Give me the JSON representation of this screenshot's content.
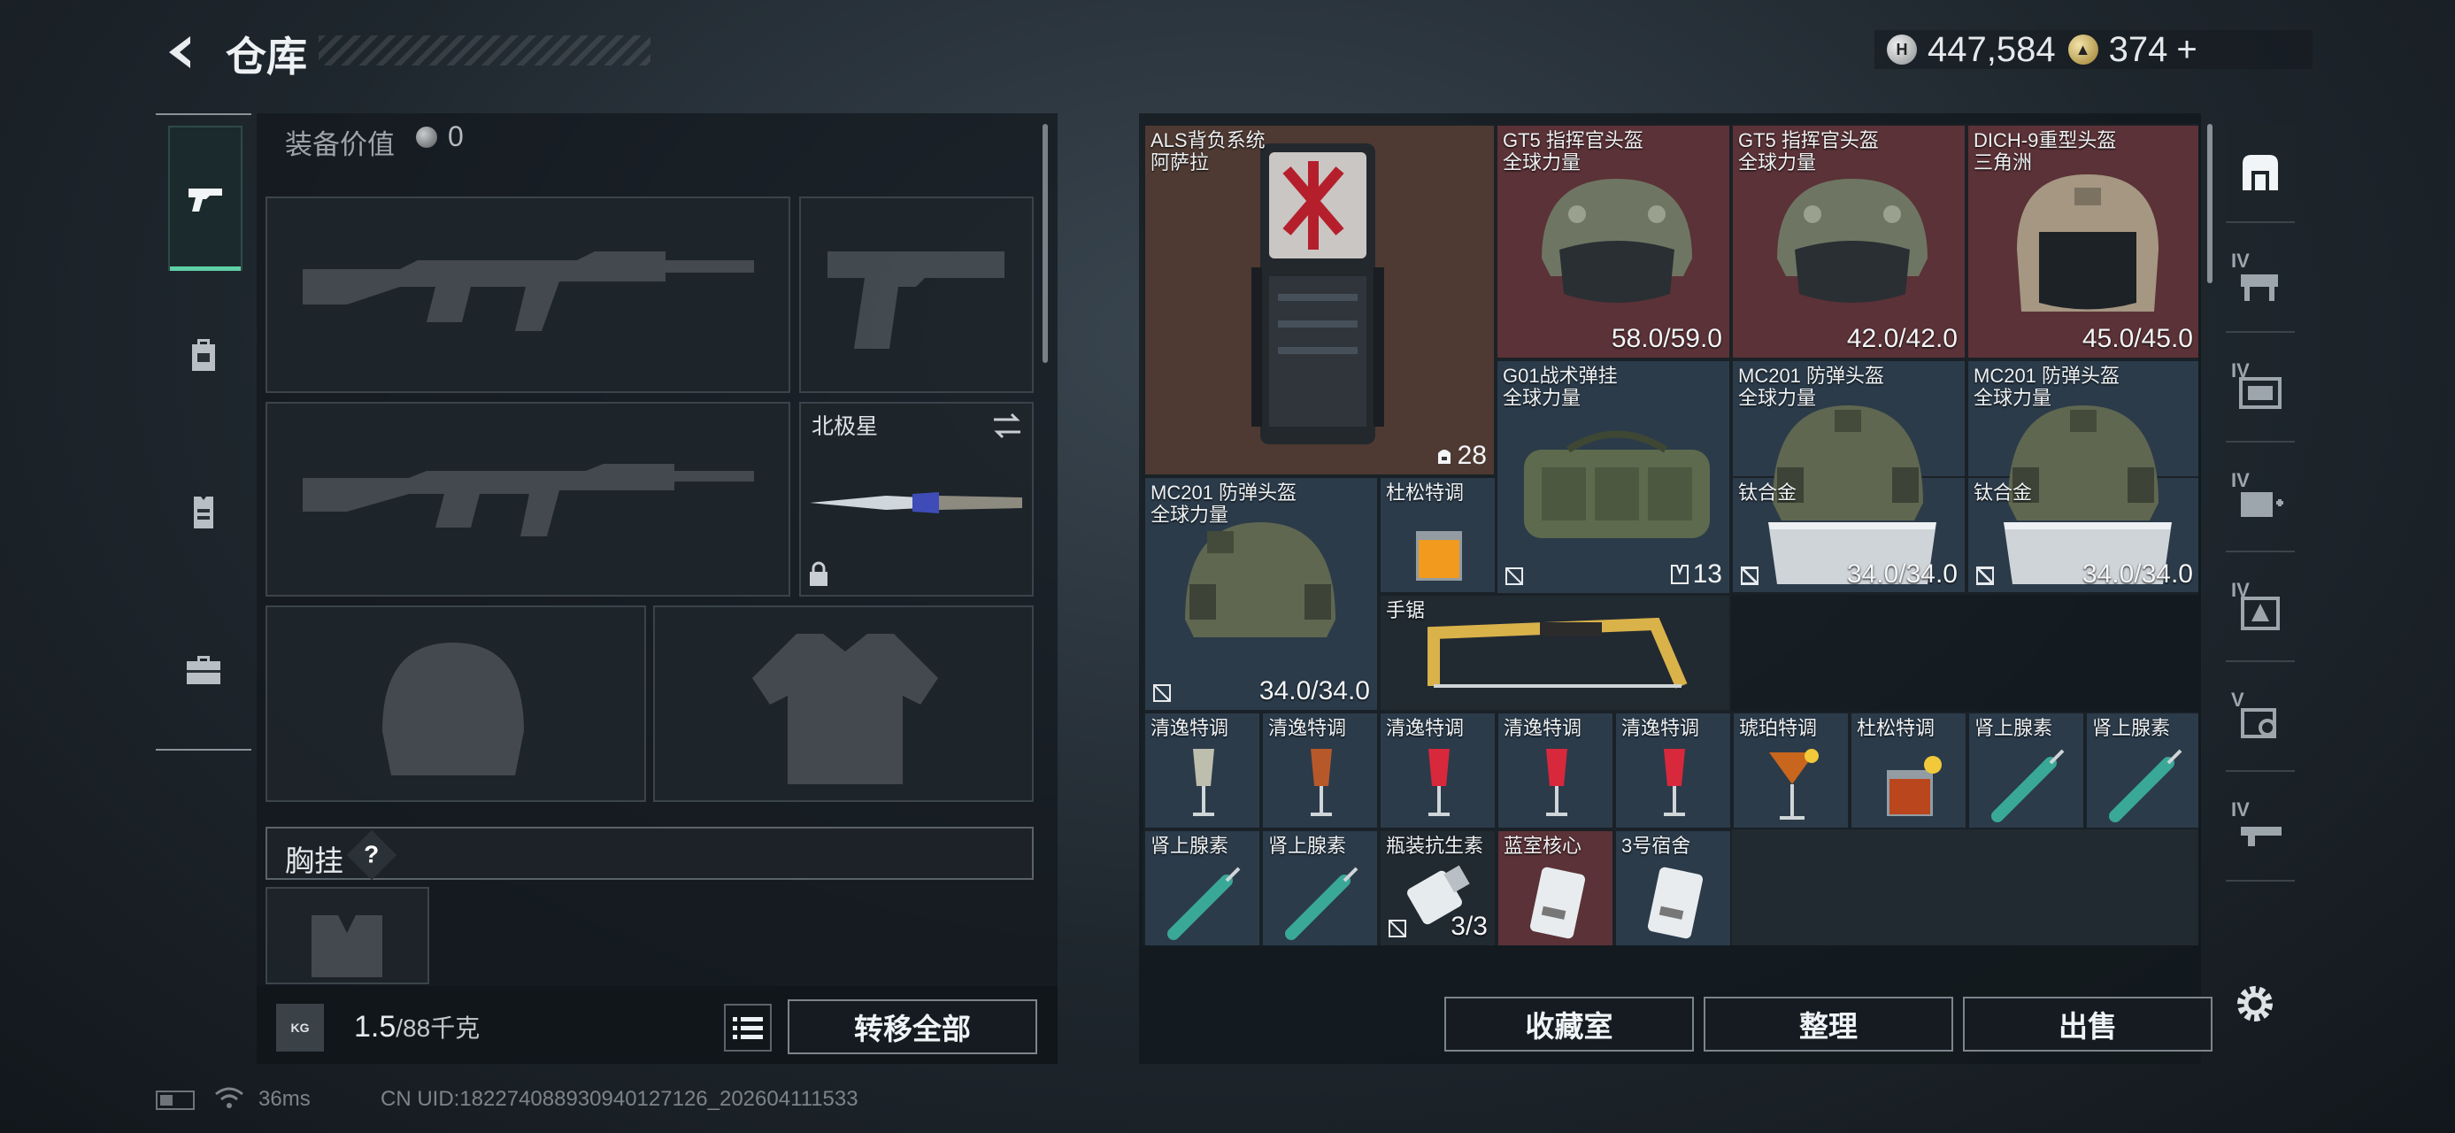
{
  "header": {
    "title": "仓库",
    "silver": "447,584",
    "gold": "374",
    "gold_add": "+"
  },
  "categories": [
    {
      "name": "weapons",
      "icon": "pistol-icon",
      "active": true
    },
    {
      "name": "backpack",
      "icon": "backpack-icon",
      "active": false
    },
    {
      "name": "chest-rig",
      "icon": "vest-icon",
      "active": false
    },
    {
      "name": "case",
      "icon": "briefcase-icon",
      "active": false
    }
  ],
  "equipment": {
    "value_label": "装备价值",
    "value": "0",
    "melee_name": "北极星",
    "chest_label": "胸挂",
    "chest_help": "?",
    "weight_current": "1.5",
    "weight_max": "/88千克",
    "transfer_all": "转移全部"
  },
  "items": [
    {
      "name": "ALS背负系统",
      "sub": "阿萨拉",
      "count": "28"
    },
    {
      "name": "GT5 指挥官头盔",
      "sub": "全球力量",
      "durability": "58.0/59.0"
    },
    {
      "name": "GT5 指挥官头盔",
      "sub": "全球力量",
      "durability": "42.0/42.0"
    },
    {
      "name": "DICH-9重型头盔",
      "sub": "三角洲",
      "durability": "45.0/45.0"
    },
    {
      "name": "G01战术弹挂",
      "sub": "全球力量",
      "count": "13"
    },
    {
      "name": "MC201 防弹头盔",
      "sub": "全球力量",
      "durability": "34.0/34.0"
    },
    {
      "name": "MC201 防弹头盔",
      "sub": "全球力量",
      "durability": "34.0/34.0"
    },
    {
      "name": "MC201 防弹头盔",
      "sub": "全球力量",
      "durability": "34.0/34.0"
    },
    {
      "name": "杜松特调"
    },
    {
      "name": "手锯"
    },
    {
      "name": "钛合金"
    },
    {
      "name": "钛合金"
    },
    {
      "name": "清逸特调"
    },
    {
      "name": "清逸特调"
    },
    {
      "name": "清逸特调"
    },
    {
      "name": "清逸特调"
    },
    {
      "name": "清逸特调"
    },
    {
      "name": "琥珀特调"
    },
    {
      "name": "杜松特调"
    },
    {
      "name": "肾上腺素"
    },
    {
      "name": "肾上腺素"
    },
    {
      "name": "肾上腺素"
    },
    {
      "name": "肾上腺素"
    },
    {
      "name": "瓶装抗生素",
      "count": "3/3"
    },
    {
      "name": "蓝室核心"
    },
    {
      "name": "3号宿舍"
    }
  ],
  "actions": {
    "collection": "收藏室",
    "sort": "整理",
    "sell": "出售"
  },
  "filters": [
    {
      "icon": "storage-icon",
      "level": ""
    },
    {
      "icon": "workbench-icon",
      "level": "IV"
    },
    {
      "icon": "tech-center-icon",
      "level": "IV"
    },
    {
      "icon": "medical-station-icon",
      "level": "IV"
    },
    {
      "icon": "armor-bench-icon",
      "level": "IV"
    },
    {
      "icon": "control-room-icon",
      "level": "V"
    },
    {
      "icon": "firearm-bench-icon",
      "level": "IV"
    }
  ],
  "status": {
    "ping": "36ms",
    "uid": "CN UID:18227408893094012712​6_202604111533"
  }
}
